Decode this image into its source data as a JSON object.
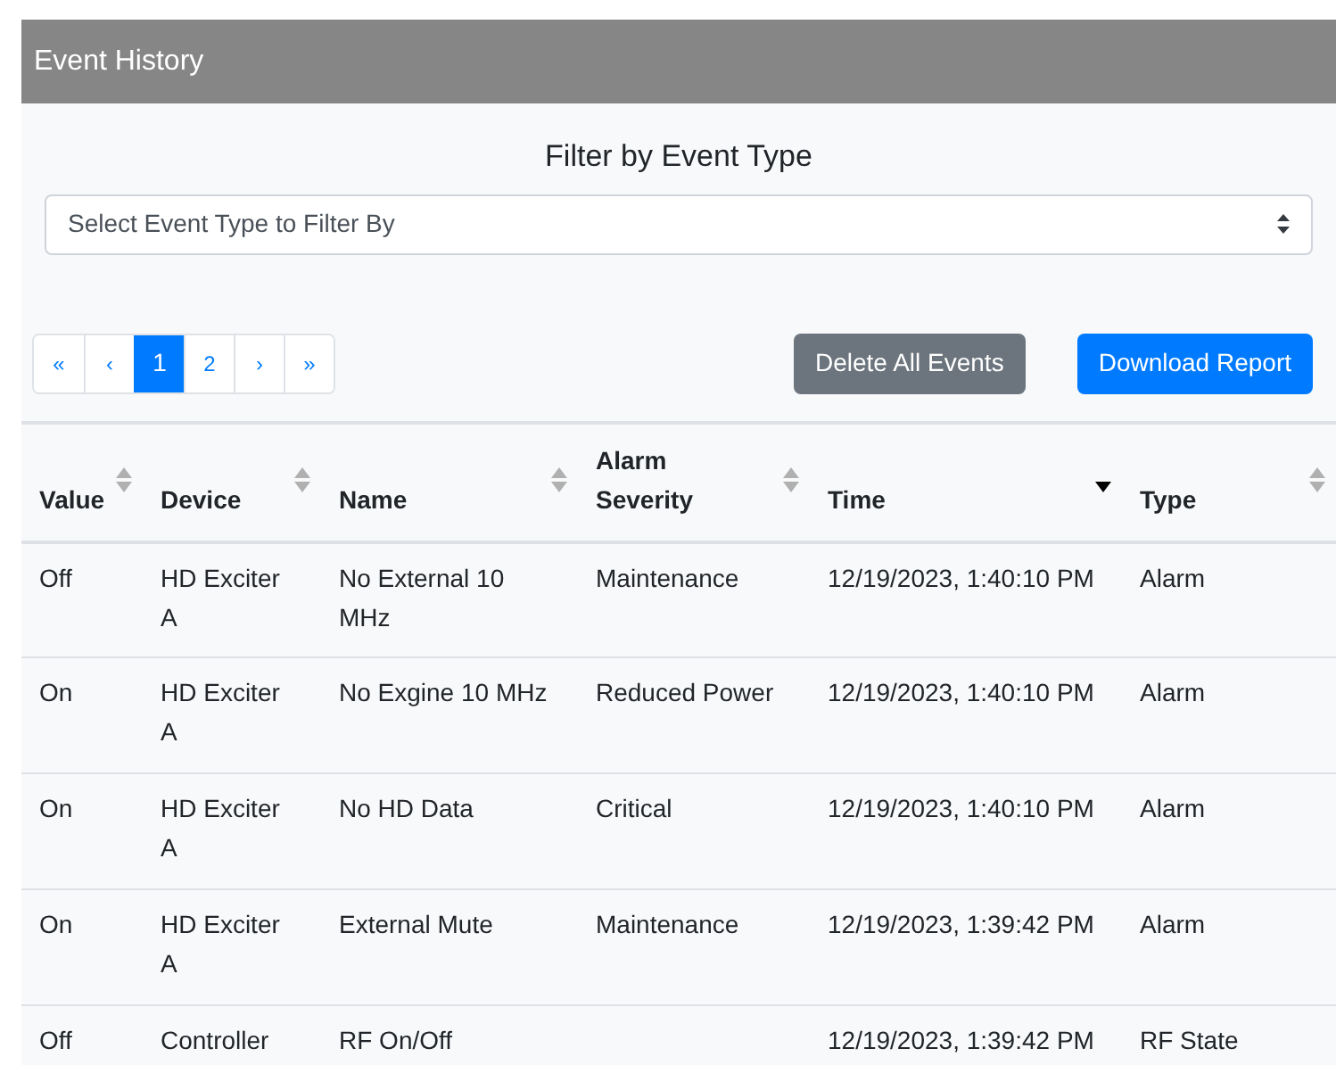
{
  "panel": {
    "title": "Event History"
  },
  "filter": {
    "heading": "Filter by Event Type",
    "placeholder": "Select Event Type to Filter By"
  },
  "pagination": [
    {
      "label": "«",
      "selected": false
    },
    {
      "label": "‹",
      "selected": false
    },
    {
      "label": "1",
      "selected": true
    },
    {
      "label": "2",
      "selected": false
    },
    {
      "label": "›",
      "selected": false
    },
    {
      "label": "»",
      "selected": false
    }
  ],
  "buttons": [
    {
      "label": "Delete All Events",
      "kind": "secondary"
    },
    {
      "label": "Download Report",
      "kind": "primary"
    }
  ],
  "table": {
    "columns": [
      {
        "label": "Value",
        "sorted": false
      },
      {
        "label": "Device",
        "sorted": false
      },
      {
        "label": "Name",
        "sorted": false
      },
      {
        "label": "Alarm Severity",
        "sorted": false
      },
      {
        "label": "Time",
        "sorted": true
      },
      {
        "label": "Type",
        "sorted": false
      }
    ],
    "rows": [
      [
        "Off",
        "HD Exciter A",
        "No External 10 MHz",
        "Maintenance",
        "12/19/2023, 1:40:10 PM",
        "Alarm"
      ],
      [
        "On",
        "HD Exciter A",
        "No Exgine 10 MHz",
        "Reduced Power",
        "12/19/2023, 1:40:10 PM",
        "Alarm"
      ],
      [
        "On",
        "HD Exciter A",
        "No HD Data",
        "Critical",
        "12/19/2023, 1:40:10 PM",
        "Alarm"
      ],
      [
        "On",
        "HD Exciter A",
        "External Mute",
        "Maintenance",
        "12/19/2023, 1:39:42 PM",
        "Alarm"
      ],
      [
        "Off",
        "Controller",
        "RF On/Off",
        "",
        "12/19/2023, 1:39:42 PM",
        "RF State"
      ]
    ]
  }
}
